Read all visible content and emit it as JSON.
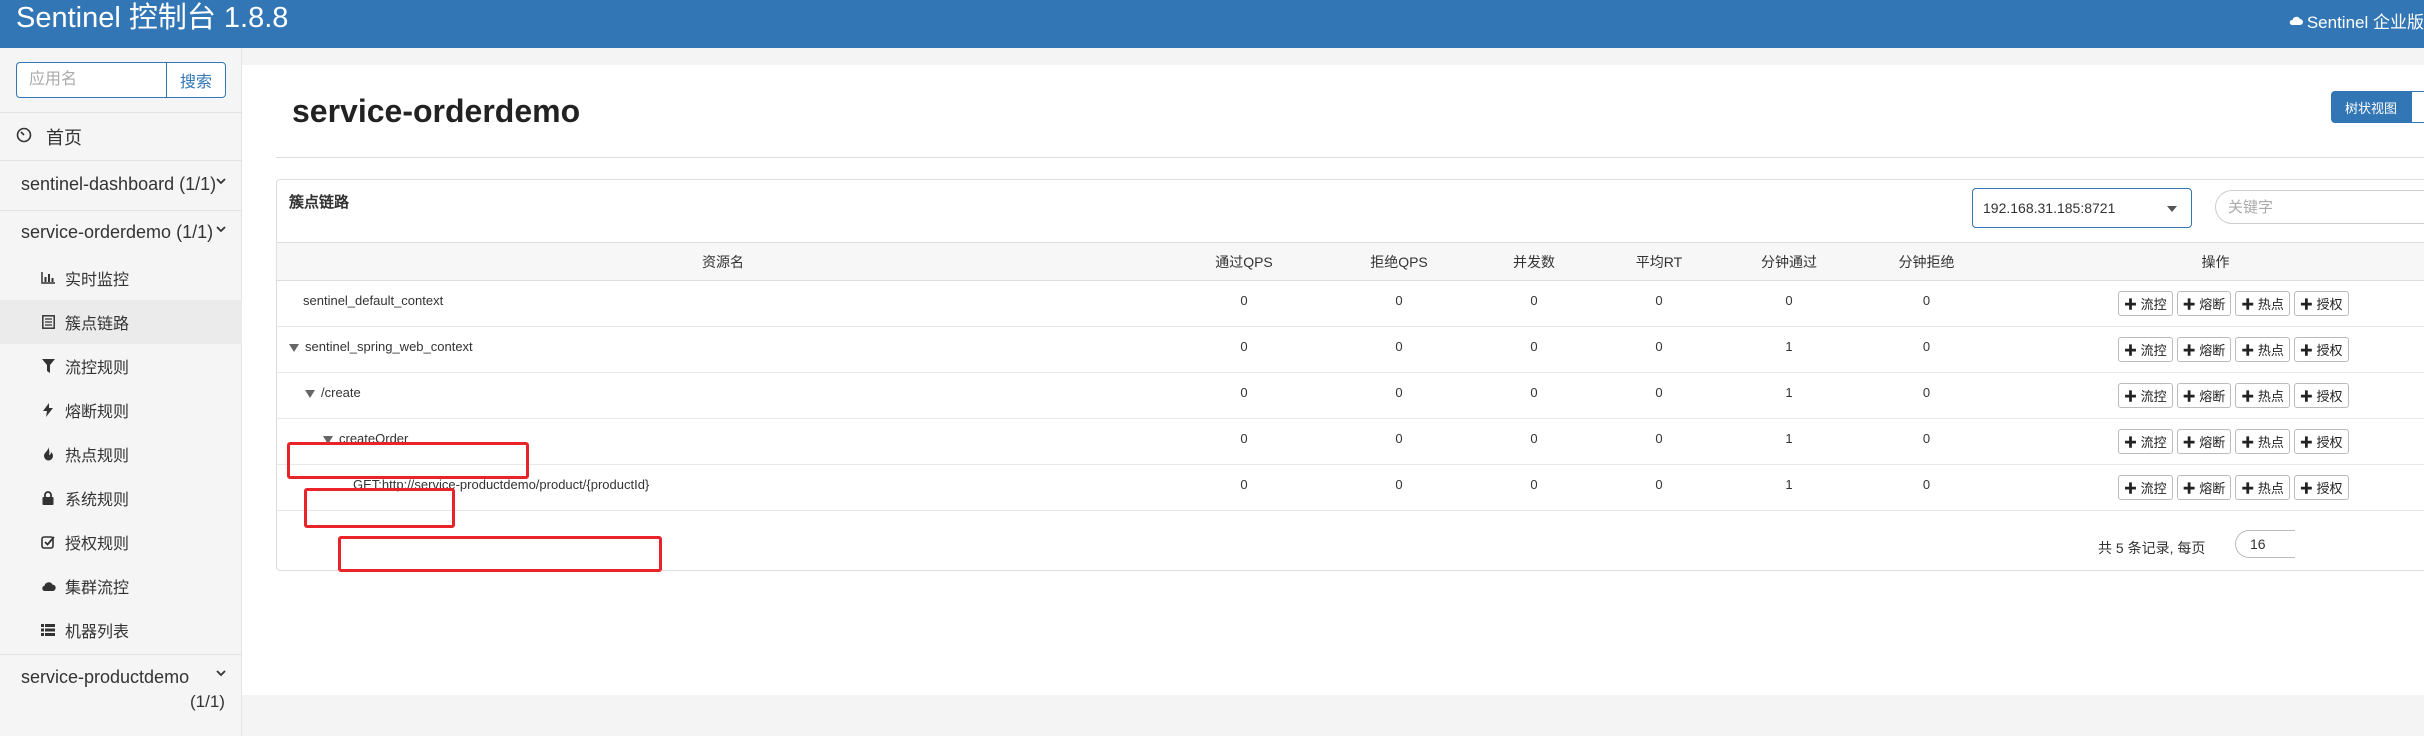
{
  "header": {
    "brand": "Sentinel 控制台 1.8.8",
    "enterprise": "Sentinel 企业版"
  },
  "sidebar": {
    "search_placeholder": "应用名",
    "search_button": "搜索",
    "home": "首页",
    "apps": [
      {
        "name": "sentinel-dashboard",
        "count": "(1/1)"
      },
      {
        "name": "service-orderdemo",
        "count": "(1/1)"
      },
      {
        "name": "service-productdemo",
        "count": "(1/1)"
      }
    ],
    "menu": [
      {
        "label": "实时监控",
        "icon": "bar-chart-icon"
      },
      {
        "label": "簇点链路",
        "icon": "list-icon"
      },
      {
        "label": "流控规则",
        "icon": "filter-icon"
      },
      {
        "label": "熔断规则",
        "icon": "flash-icon"
      },
      {
        "label": "热点规则",
        "icon": "fire-icon"
      },
      {
        "label": "系统规则",
        "icon": "lock-icon"
      },
      {
        "label": "授权规则",
        "icon": "check-icon"
      },
      {
        "label": "集群流控",
        "icon": "cloud-icon"
      },
      {
        "label": "机器列表",
        "icon": "th-list-icon"
      }
    ]
  },
  "main": {
    "title": "service-orderdemo",
    "view_button": "树状视图",
    "card_title": "簇点链路",
    "machine": "192.168.31.185:8721",
    "keyword_placeholder": "关键字",
    "columns": [
      "资源名",
      "通过QPS",
      "拒绝QPS",
      "并发数",
      "平均RT",
      "分钟通过",
      "分钟拒绝",
      "操作"
    ],
    "rows": [
      {
        "name": "sentinel_default_context",
        "pass_qps": "0",
        "block_qps": "0",
        "concurrency": "0",
        "avg_rt": "0",
        "min_pass": "0",
        "min_block": "0"
      },
      {
        "name": "sentinel_spring_web_context",
        "pass_qps": "0",
        "block_qps": "0",
        "concurrency": "0",
        "avg_rt": "0",
        "min_pass": "1",
        "min_block": "0"
      },
      {
        "name": "/create",
        "pass_qps": "0",
        "block_qps": "0",
        "concurrency": "0",
        "avg_rt": "0",
        "min_pass": "1",
        "min_block": "0"
      },
      {
        "name": "createOrder",
        "pass_qps": "0",
        "block_qps": "0",
        "concurrency": "0",
        "avg_rt": "0",
        "min_pass": "1",
        "min_block": "0"
      },
      {
        "name": "GET:http://service-productdemo/product/{productId}",
        "pass_qps": "0",
        "block_qps": "0",
        "concurrency": "0",
        "avg_rt": "0",
        "min_pass": "1",
        "min_block": "0"
      }
    ],
    "ops": [
      "✚ 流控",
      "✚ 熔断",
      "✚ 热点",
      "✚ 授权"
    ],
    "pager_text": "共 5 条记录, 每页",
    "page_size": "16"
  },
  "colors": {
    "brand": "#3276b5",
    "highlight": "#e8232a"
  }
}
